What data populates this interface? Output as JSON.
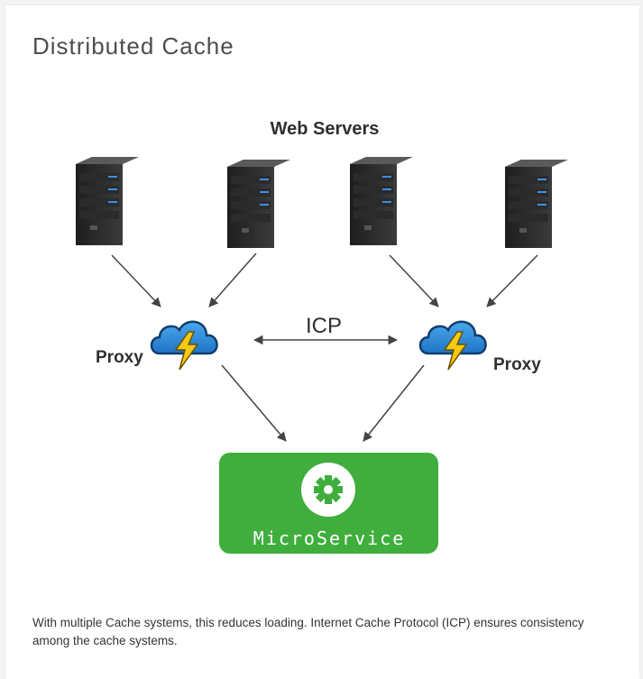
{
  "title": "Distributed Cache",
  "diagram": {
    "group_label": "Web Servers",
    "protocol_label": "ICP",
    "proxy_left_label": "Proxy",
    "proxy_right_label": "Proxy",
    "service_label": "MicroService",
    "server_icon": "server-tower-icon",
    "proxy_icon": "cloud-lightning-icon",
    "service_icon": "gear-icon",
    "colors": {
      "service_green": "#3fae3c",
      "cloud_blue": "#2f8fd8",
      "bolt_yellow": "#f6c915",
      "server_led_blue": "#3d8fe0"
    }
  },
  "caption": "With multiple Cache systems, this reduces loading. Internet Cache Protocol (ICP) ensures consistency among the cache systems."
}
